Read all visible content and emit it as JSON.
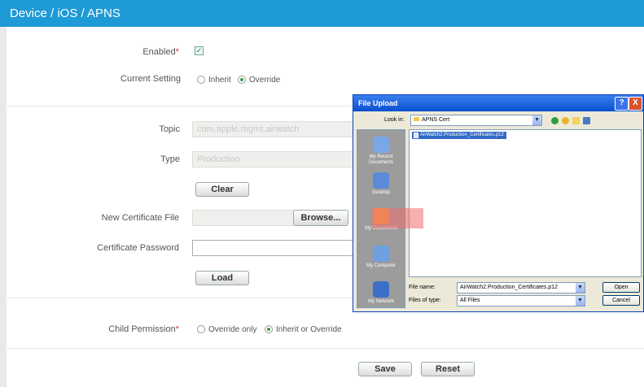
{
  "header": {
    "title": "Device / iOS / APNS"
  },
  "form": {
    "enabled_label": "Enabled",
    "required_mark": "*",
    "current_setting_label": "Current Setting",
    "inherit_label": "Inherit",
    "override_label": "Override",
    "topic_label": "Topic",
    "topic_value": "com.apple.mgmt.airwatch",
    "type_label": "Type",
    "type_value": "Production",
    "clear_button": "Clear",
    "new_cert_label": "New Certificate File",
    "browse_button": "Browse...",
    "cert_password_label": "Certificate Password",
    "load_button": "Load",
    "child_permission_label": "Child Permission",
    "override_only_label": "Override only",
    "inherit_or_override_label": "Inherit or Override",
    "save_button": "Save",
    "reset_button": "Reset"
  },
  "dialog": {
    "title": "File Upload",
    "help_btn": "?",
    "close_btn": "X",
    "look_in_label": "Look in:",
    "look_in_value": "APNS Cert",
    "places": [
      "My Recent Documents",
      "Desktop",
      "My Documents",
      "My Computer",
      "My Network"
    ],
    "selected_file": "AirWatch2.Production_Certificates.p12",
    "file_name_label": "File name:",
    "file_name_value": "AirWatch2.Production_Certificates.p12",
    "files_of_type_label": "Files of type:",
    "files_of_type_value": "All Files",
    "open_button": "Open",
    "cancel_button": "Cancel"
  },
  "colors": {
    "header": "#1e9ad6",
    "dialog_title": "#0a4fd0",
    "highlight": "#f06e6e"
  }
}
